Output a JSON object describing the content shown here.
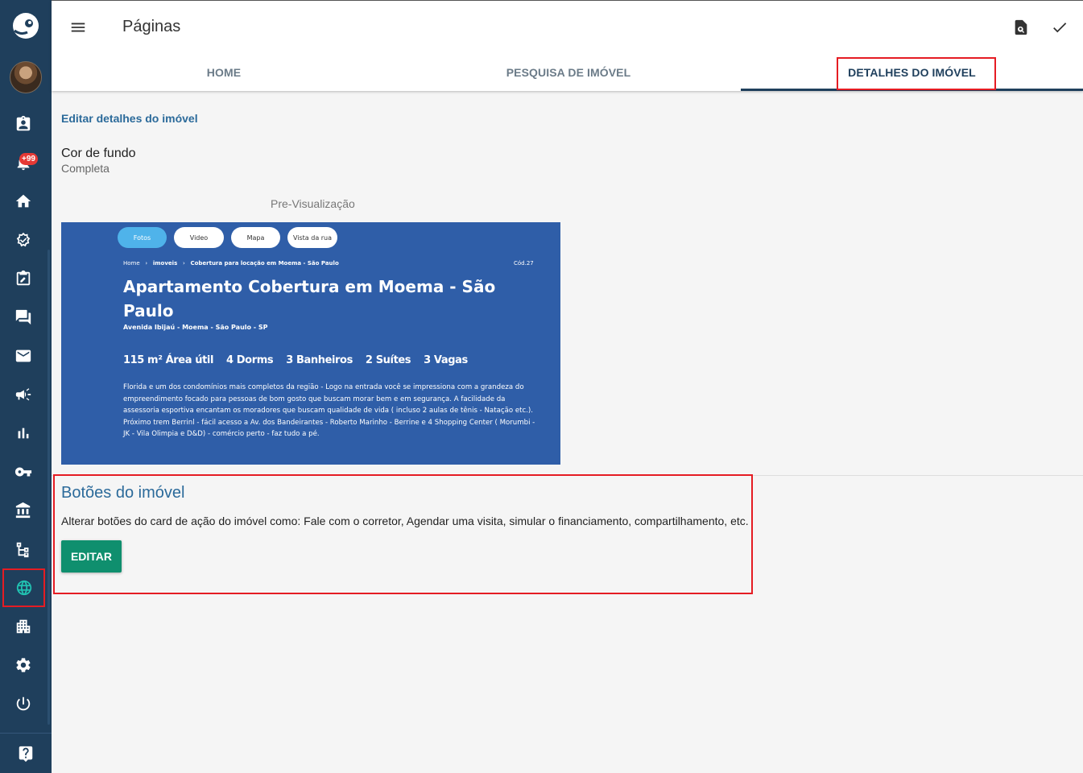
{
  "header": {
    "title": "Páginas",
    "icons": [
      "menu-icon",
      "preview-search-icon",
      "check-icon"
    ]
  },
  "tabs": [
    {
      "label": "HOME",
      "active": false
    },
    {
      "label": "PESQUISA DE IMÓVEL",
      "active": false
    },
    {
      "label": "DETALHES DO IMÓVEL",
      "active": true
    }
  ],
  "sidebar": {
    "badge": "+99",
    "items": [
      "contacts-icon",
      "notifications-icon",
      "home-icon",
      "verified-icon",
      "edit-note-icon",
      "chat-icon",
      "mail-icon",
      "campaign-icon",
      "bar-chart-icon",
      "key-icon",
      "bank-icon",
      "hierarchy-icon",
      "globe-icon",
      "buildings-icon",
      "settings-icon",
      "power-icon"
    ],
    "active_item": "globe-icon",
    "footer_icon": "help-icon"
  },
  "details": {
    "section_title": "Editar detalhes do imóvel",
    "background_label": "Cor de fundo",
    "background_value": "Completa",
    "preview_label": "Pre-Visualização"
  },
  "preview": {
    "pills": [
      {
        "label": "Fotos",
        "active": true
      },
      {
        "label": "Video",
        "active": false
      },
      {
        "label": "Mapa",
        "active": false
      },
      {
        "label": "Vista da rua",
        "active": false
      }
    ],
    "breadcrumb": {
      "home": "Home",
      "sep": "›",
      "imoveis": "imoveis",
      "current": "Cobertura para locação em Moema - São Paulo"
    },
    "code": "Cód.27",
    "title": "Apartamento Cobertura em Moema - São Paulo",
    "address": "Avenida Ibijaú - Moema - São Paulo - SP",
    "features": [
      "115 m² Área útil",
      "4 Dorms",
      "3 Banheiros",
      "2 Suítes",
      "3 Vagas"
    ],
    "description": "Florida e um dos condomínios mais completos da região - Logo na entrada você se impressiona com a grandeza do empreendimento focado para pessoas de bom gosto que buscam morar bem e em segurança. A facilidade da assessoria esportiva encantam os moradores que buscam qualidade de vida ( incluso 2 aulas de tênis - Natação etc.). Próximo trem Berrinl - fácil acesso a Av. dos Bandeirantes - Roberto Marinho - Berrine e 4 Shopping Center ( Morumbi - JK - Vila Olimpia e D&D) - comércio perto - faz tudo a pé.",
    "background_color": "#2f5ea8",
    "active_pill_color": "#4fb3ea"
  },
  "buttons_section": {
    "title": "Botões do imóvel",
    "description": "Alterar botões do card de ação do imóvel como: Fale com o corretor, Agendar uma visita, simular o financiamento, compartilhamento, etc.",
    "edit_label": "EDITAR"
  },
  "colors": {
    "sidebar": "#1f3f5c",
    "accent_teal": "#0f8f6e",
    "heading_blue": "#2b6a9a",
    "highlight_red": "#e51c23"
  }
}
